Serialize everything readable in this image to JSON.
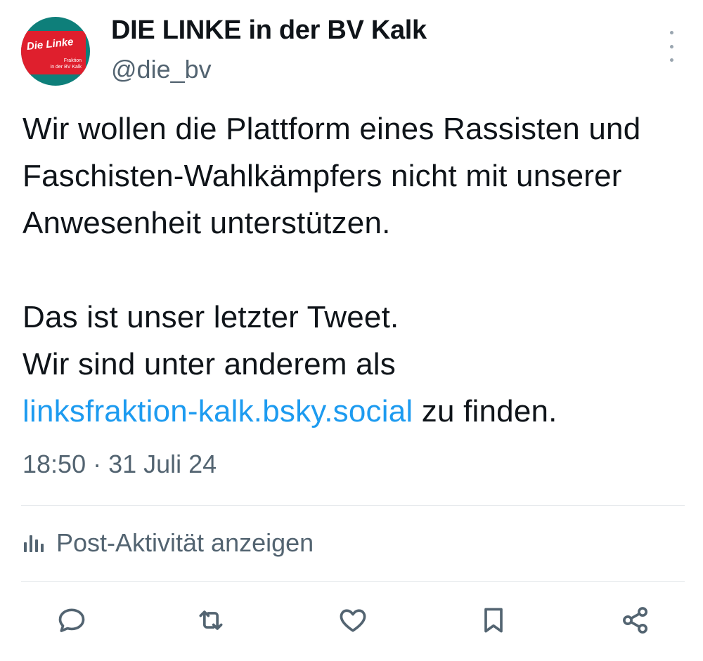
{
  "author": {
    "display_name": "DIE LINKE in der BV Kalk",
    "handle": "@die_bv",
    "avatar": {
      "brand_text": "Die Linke",
      "sub_text": "Fraktion\nin der BV Kalk",
      "colors": {
        "background": "#0e7f7a",
        "banner": "#df1f2d",
        "text": "#ffffff"
      }
    }
  },
  "post": {
    "paragraph1": "Wir wollen die Plattform eines Rassisten und Faschisten-Wahlkämpfers nicht mit unserer Anwesenheit unterstützen.",
    "line2": "Das ist unser letzter Tweet.",
    "line3": "Wir sind unter anderem als",
    "link_text": "linksfraktion-kalk.bsky.social",
    "line3_suffix": " zu finden.",
    "timestamp": "18:50 · 31 Juli 24"
  },
  "activity": {
    "label": "Post-Aktivität anzeigen",
    "icon": "bar-chart-icon"
  },
  "actions": [
    {
      "name": "reply",
      "icon": "speech-bubble-icon"
    },
    {
      "name": "repost",
      "icon": "repost-arrows-icon"
    },
    {
      "name": "like",
      "icon": "heart-icon"
    },
    {
      "name": "bookmark",
      "icon": "bookmark-icon"
    },
    {
      "name": "share",
      "icon": "share-nodes-icon"
    }
  ],
  "colors": {
    "text": "#0f1419",
    "secondary": "#536471",
    "link": "#1d9bf0",
    "divider": "#e6e9ec"
  }
}
